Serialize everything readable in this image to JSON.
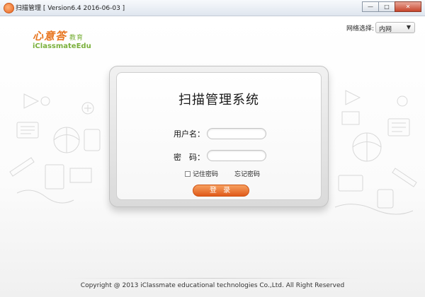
{
  "window": {
    "title": "扫描管理 [ Version6.4 2016-06-03 ]",
    "controls": {
      "minimize": "—",
      "maximize": "□",
      "close": "✕"
    }
  },
  "logo": {
    "cn": "心意答",
    "cn_sub": "教育",
    "en": "iClassmateEdu"
  },
  "network": {
    "label": "网络选择:",
    "value": "内网",
    "arrow": "▼"
  },
  "login": {
    "title": "扫描管理系统",
    "username_label": "用户名：",
    "password_label": "密　码：",
    "username_value": "",
    "password_value": "",
    "remember_label": "记住密码",
    "forgot_label": "忘记密码",
    "button_label": "登 录"
  },
  "footer": "Copyright @ 2013 iClassmate educational technologies Co.,Ltd. All Right Reserved",
  "colors": {
    "accent": "#e87722",
    "brand_green": "#7ab03b",
    "button": "#e05a1a"
  },
  "icons": [
    "app-icon",
    "chevron-down-icon",
    "doodle-illustration"
  ]
}
